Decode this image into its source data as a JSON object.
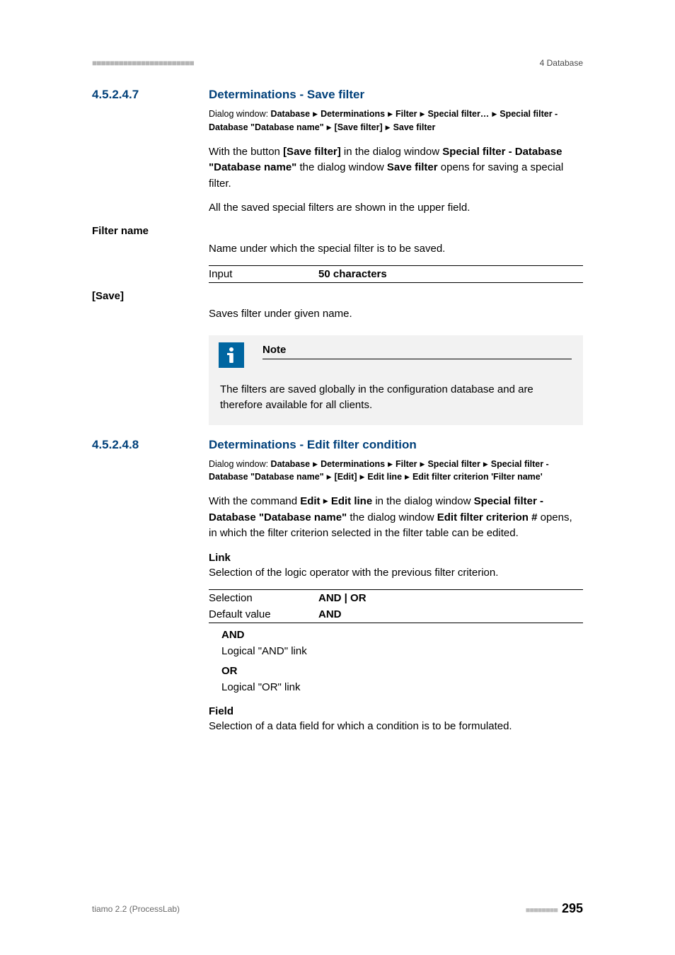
{
  "header": {
    "left_bar": "■■■■■■■■■■■■■■■■■■■■■■■",
    "right": "4 Database"
  },
  "sec1": {
    "num": "4.5.2.4.7",
    "title": "Determinations - Save filter",
    "dlg_prefix": "Dialog window: ",
    "dlg_parts": [
      "Database",
      "Determinations",
      "Filter",
      "Special filter…",
      "Special filter - Database \"Database name\"",
      "[Save filter]",
      "Save filter"
    ],
    "p1_a": "With the button ",
    "p1_b": "[Save filter]",
    "p1_c": " in the dialog window ",
    "p1_d": "Special filter - Database \"Database name\"",
    "p1_e": " the dialog window ",
    "p1_f": "Save filter",
    "p1_g": " opens for saving a special filter.",
    "p2": "All the saved special filters are shown in the upper field.",
    "filter_name_label": "Filter name",
    "filter_name_desc": "Name under which the special filter is to be saved.",
    "input_row_l": "Input",
    "input_row_v": "50 characters",
    "save_label": "[Save]",
    "save_desc": "Saves filter under given name.",
    "note_title": "Note",
    "note_body": "The filters are saved globally in the configuration database and are therefore available for all clients."
  },
  "sec2": {
    "num": "4.5.2.4.8",
    "title": "Determinations - Edit filter condition",
    "dlg_prefix": "Dialog window: ",
    "dlg_parts": [
      "Database",
      "Determinations",
      "Filter",
      "Special filter",
      "Special filter - Database \"Database name\"",
      "[Edit]",
      "Edit line",
      "Edit filter criterion 'Filter name'"
    ],
    "p1_a": "With the command ",
    "p1_b": "Edit",
    "p1_c": "Edit line",
    "p1_d": " in the dialog window ",
    "p1_e": "Special filter - Database \"Database name\"",
    "p1_f": " the dialog window ",
    "p1_g": "Edit filter criterion #",
    "p1_h": " opens, in which the filter criterion selected in the filter table can be edited.",
    "link_head": "Link",
    "link_desc": "Selection of the logic operator with the previous filter criterion.",
    "sel_row_l": "Selection",
    "sel_row_v": "AND | OR",
    "def_row_l": "Default value",
    "def_row_v": "AND",
    "and_term": "AND",
    "and_desc": "Logical \"AND\" link",
    "or_term": "OR",
    "or_desc": "Logical \"OR\" link",
    "field_head": "Field",
    "field_desc": "Selection of a data field for which a condition is to be formulated."
  },
  "footer": {
    "left": "tiamo 2.2 (ProcessLab)",
    "dots": "■■■■■■■■",
    "page": "295"
  }
}
